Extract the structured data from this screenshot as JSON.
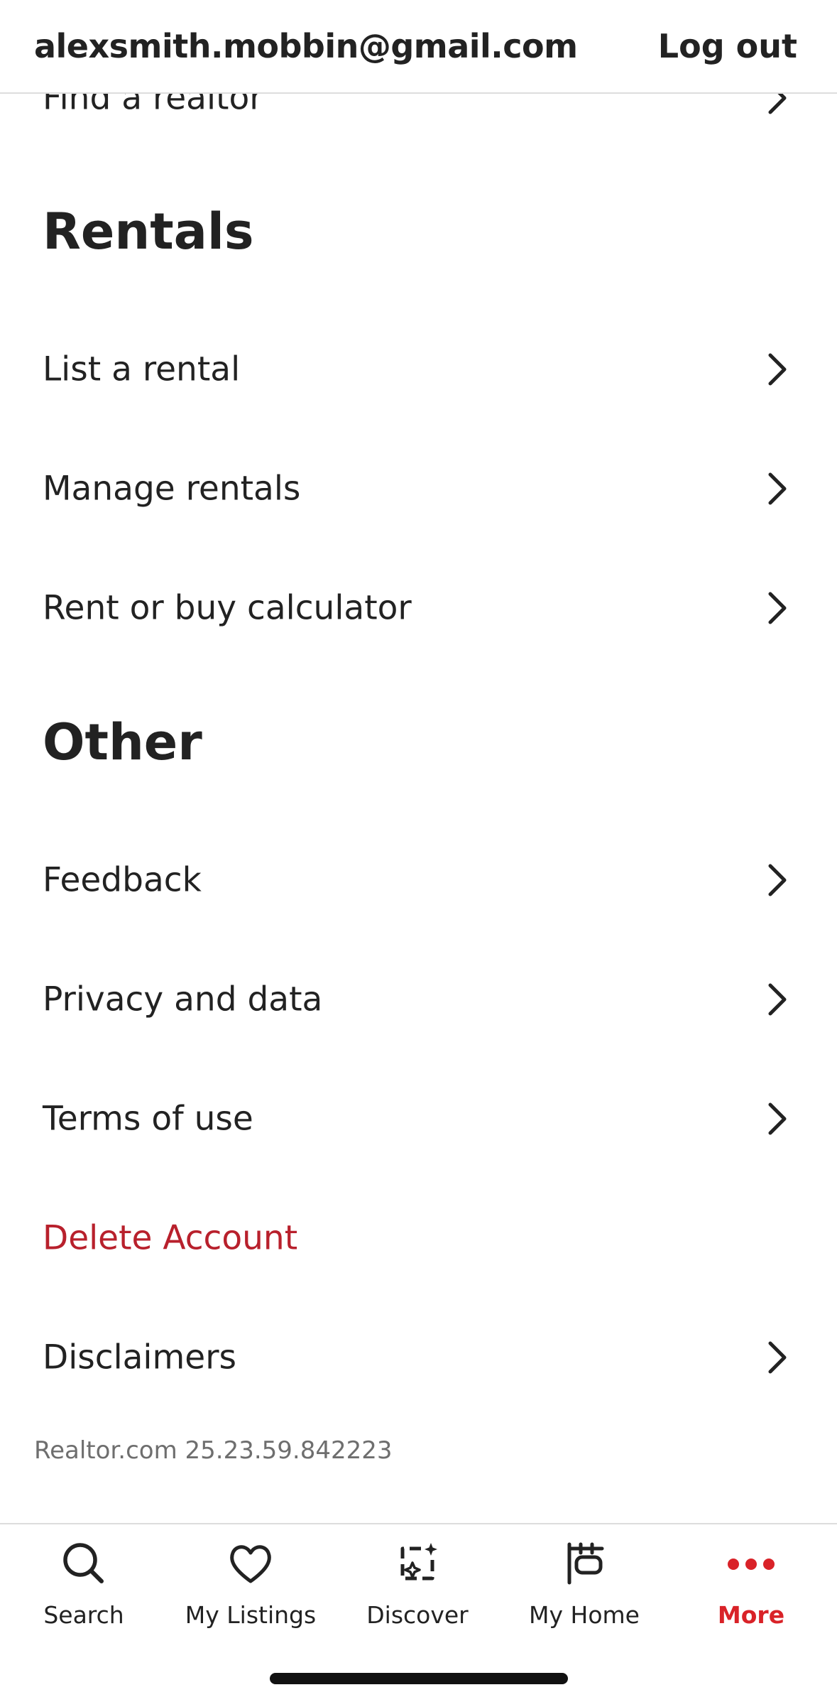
{
  "header": {
    "email": "alexsmith.mobbin@gmail.com",
    "logout_label": "Log out"
  },
  "partial_item": {
    "label": "Find a realtor"
  },
  "sections": {
    "rentals": {
      "title": "Rentals",
      "items": [
        {
          "label": "List a rental"
        },
        {
          "label": "Manage rentals"
        },
        {
          "label": "Rent or buy calculator"
        }
      ]
    },
    "other": {
      "title": "Other",
      "items": [
        {
          "label": "Feedback"
        },
        {
          "label": "Privacy and data"
        },
        {
          "label": "Terms of use"
        },
        {
          "label": "Delete Account"
        },
        {
          "label": "Disclaimers"
        }
      ]
    }
  },
  "version_text": "Realtor.com 25.23.59.842223",
  "tabbar": {
    "tabs": [
      {
        "label": "Search",
        "icon": "search-icon"
      },
      {
        "label": "My Listings",
        "icon": "heart-icon"
      },
      {
        "label": "Discover",
        "icon": "discover-icon"
      },
      {
        "label": "My Home",
        "icon": "my-home-icon"
      },
      {
        "label": "More",
        "icon": "more-dots-icon"
      }
    ],
    "active": "More"
  },
  "colors": {
    "accent": "#d92228",
    "danger_text": "#b8202c",
    "text": "#222222",
    "muted": "#6e6e6e"
  }
}
